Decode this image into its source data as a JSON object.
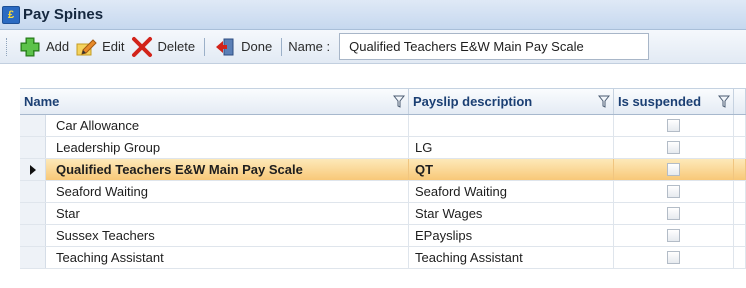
{
  "window": {
    "title": "Pay Spines",
    "icon": "pay-spines-icon"
  },
  "toolbar": {
    "add_label": "Add",
    "edit_label": "Edit",
    "delete_label": "Delete",
    "done_label": "Done",
    "name_label": "Name :",
    "name_value": "Qualified Teachers E&W Main Pay Scale"
  },
  "grid": {
    "columns": [
      "Name",
      "Payslip description",
      "Is suspended"
    ],
    "rows": [
      {
        "name": "Car Allowance",
        "payslip": "",
        "suspended": false
      },
      {
        "name": "Leadership Group",
        "payslip": "LG",
        "suspended": false
      },
      {
        "name": "Qualified Teachers E&W Main Pay Scale",
        "payslip": "QT",
        "suspended": false,
        "current": true
      },
      {
        "name": "Seaford Waiting",
        "payslip": "Seaford Waiting",
        "suspended": false
      },
      {
        "name": "Star",
        "payslip": "Star Wages",
        "suspended": false
      },
      {
        "name": "Sussex Teachers",
        "payslip": "EPayslips",
        "suspended": false
      },
      {
        "name": "Teaching Assistant",
        "payslip": "Teaching Assistant",
        "suspended": false
      }
    ]
  },
  "colors": {
    "accent": "#f8c878",
    "header_text": "#1b3f73",
    "title_bar": "#c6d8ef"
  }
}
